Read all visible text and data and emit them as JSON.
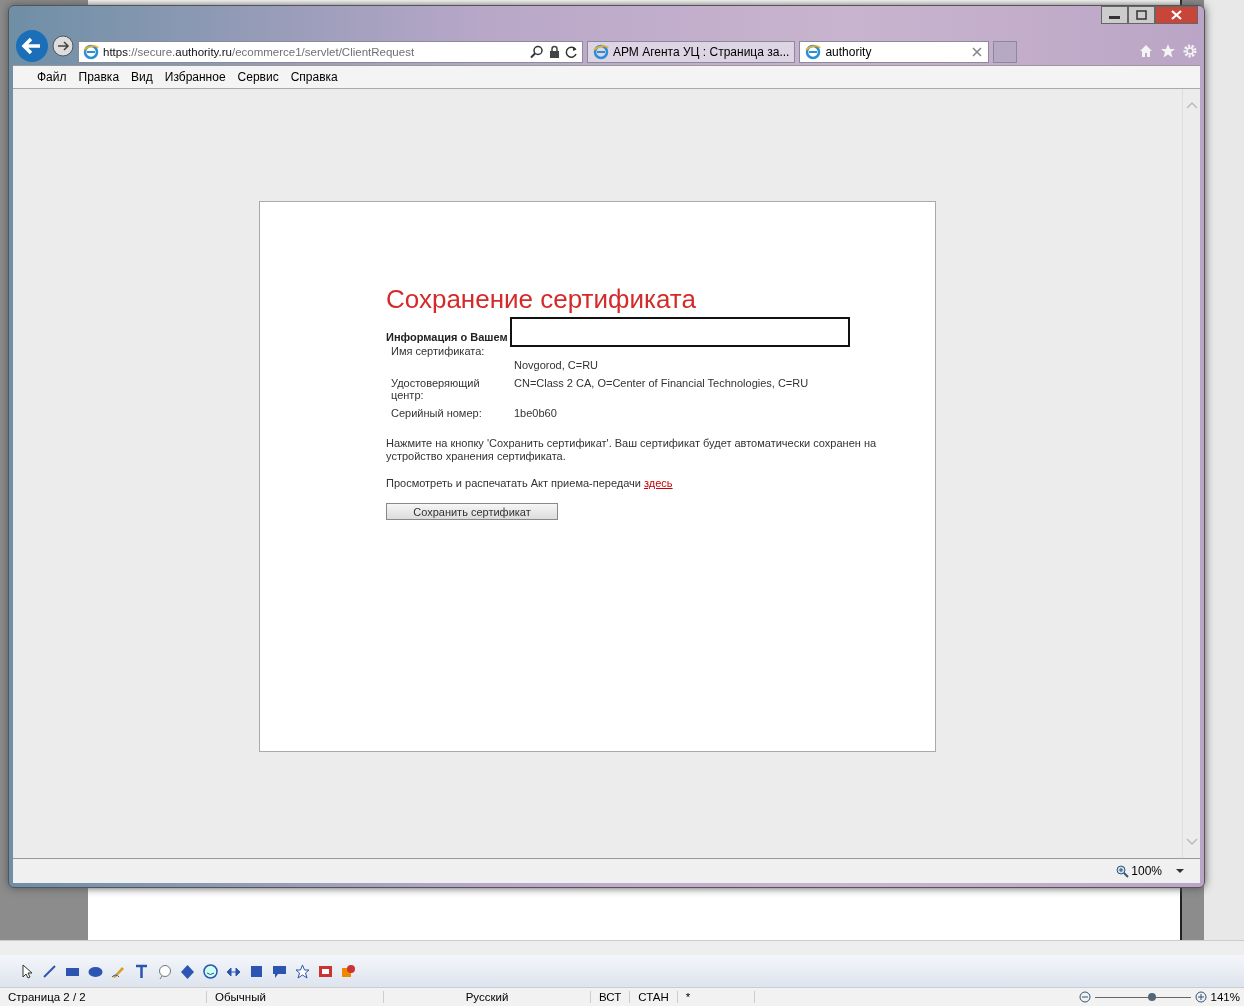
{
  "browser": {
    "url": [
      {
        "text": "https",
        "dim": false
      },
      {
        "text": "://secure.",
        "dim": true
      },
      {
        "text": "authority.ru",
        "dim": false
      },
      {
        "text": "/ecommerce1/servlet/ClientRequest",
        "dim": true
      }
    ],
    "tabs": [
      {
        "label": "АРМ Агента УЦ : Страница за...",
        "selected": false
      },
      {
        "label": "authority",
        "selected": true
      }
    ],
    "menu": [
      "Файл",
      "Правка",
      "Вид",
      "Избранное",
      "Сервис",
      "Справка"
    ],
    "zoom": "100%"
  },
  "page": {
    "title": "Сохранение сертификата",
    "info_heading": "Информация о Вашем",
    "fields": [
      {
        "label": "Имя сертификата:",
        "value": "Novgorod, C=RU",
        "redacted": true
      },
      {
        "label": "Удостоверяющий центр:",
        "value": "CN=Class 2 CA, O=Center of Financial Technologies, C=RU",
        "redacted": false
      },
      {
        "label": "Серийный номер:",
        "value": "1be0b60",
        "redacted": false
      }
    ],
    "instruction": "Нажмите на кнопку 'Сохранить сертификат'. Ваш сертификат будет автоматически сохранен на устройство хранения сертификата.",
    "print_text": "Просмотреть и распечатать Акт приема-передачи",
    "print_link": "здесь",
    "save_button": "Сохранить сертификат"
  },
  "editor": {
    "status": [
      "Страница 2 / 2",
      "Обычный",
      "Русский",
      "ВСТ",
      "СТАН",
      "*"
    ],
    "zoom_slider": {
      "level": 0.6
    },
    "zoom": "141%"
  }
}
